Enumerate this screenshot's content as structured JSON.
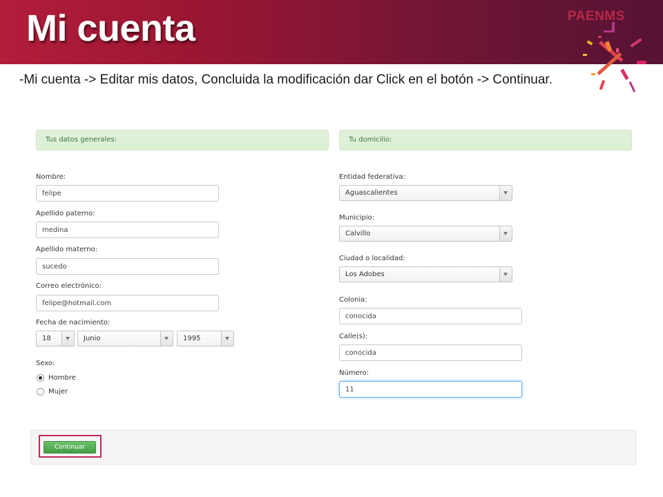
{
  "header": {
    "title": "Mi cuenta",
    "brand": "PAENMS",
    "subtitle": "-Mi cuenta -> Editar mis datos, Concluida la modificación dar Click en el botón -> Continuar."
  },
  "general": {
    "heading": "Tus datos generales:",
    "nombre": {
      "label": "Nombre:",
      "value": "felipe"
    },
    "apellido_paterno": {
      "label": "Apellido paterno:",
      "value": "medina"
    },
    "apellido_materno": {
      "label": "Apellido materno:",
      "value": "sucedo"
    },
    "correo": {
      "label": "Correo electrónico:",
      "value": "felipe@hotmail.com"
    },
    "fecha": {
      "label": "Fecha de nacimiento:",
      "day": "18",
      "month": "Junio",
      "year": "1995"
    },
    "sexo": {
      "label": "Sexo:",
      "options": [
        "Hombre",
        "Mujer"
      ],
      "selected": "Hombre"
    }
  },
  "domicilio": {
    "heading": "Tu domicilio:",
    "entidad": {
      "label": "Entidad federativa:",
      "value": "Aguascalientes"
    },
    "municipio": {
      "label": "Municipio:",
      "value": "Calvillo"
    },
    "ciudad": {
      "label": "Ciudad o localidad:",
      "value": "Los Adobes"
    },
    "colonia": {
      "label": "Colonia:",
      "value": "conocida"
    },
    "calle": {
      "label": "Calle(s):",
      "value": "conocida"
    },
    "numero": {
      "label": "Número:",
      "value": "11"
    }
  },
  "actions": {
    "continue_label": "Continuar"
  },
  "colors": {
    "banner": "#9a1633",
    "accent": "#c0285a",
    "panel_heading_bg": "#dff0d8",
    "button_green": "#449d44"
  },
  "icons": {
    "logo": "confetti-x-logo"
  }
}
